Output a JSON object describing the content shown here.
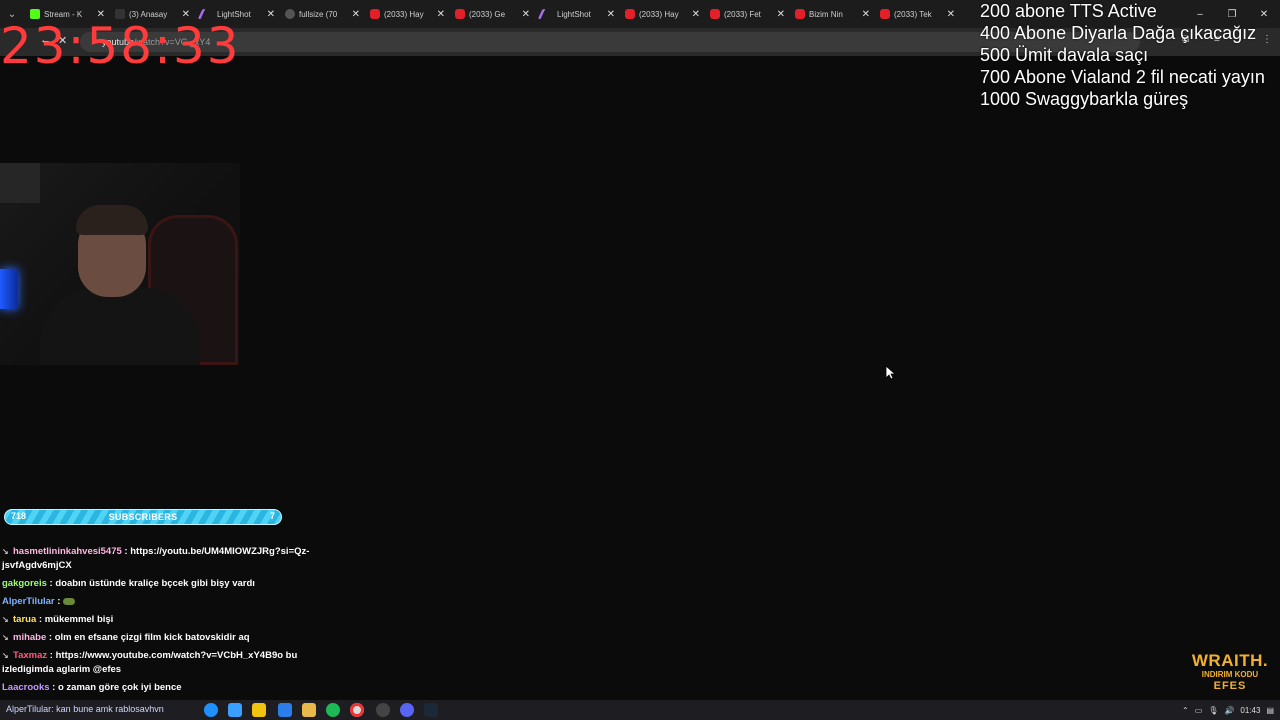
{
  "browser": {
    "tabs": [
      {
        "title": "Stream - K",
        "icon": "kick-icon"
      },
      {
        "title": "(3) Anasay",
        "icon": "x-icon"
      },
      {
        "title": "LightShot",
        "icon": "lightshot-icon"
      },
      {
        "title": "fullsize (70",
        "icon": "globe-icon"
      },
      {
        "title": "(2033) Hay",
        "icon": "youtube-icon"
      },
      {
        "title": "(2033) Ge",
        "icon": "youtube-icon"
      },
      {
        "title": "LightShot",
        "icon": "lightshot-icon"
      },
      {
        "title": "(2033) Hay",
        "icon": "youtube-icon"
      },
      {
        "title": "(2033) Fet",
        "icon": "youtube-icon"
      },
      {
        "title": "Bizim Nin",
        "icon": "youtube-icon"
      },
      {
        "title": "(2033) Tek",
        "icon": "youtube-icon"
      }
    ],
    "url_host": "youtube",
    "url_rest": "/watch?v=VC   _xY4"
  },
  "overlay": {
    "clock": "23:58:33",
    "goals": [
      "200 abone TTS Active",
      "400 Abone Diyarla Dağa çıkacağız",
      "500 Ümit davala saçı",
      "700 Abone Vialand 2 fil necati yayın",
      "1000 Swaggybarkla güreş"
    ],
    "subscribers": {
      "label": "SUBSCRIBERS",
      "current": "718",
      "right": "7"
    },
    "sponsor": {
      "brand": "WRAITH.",
      "code_label": "INDIRIM KODU",
      "code": "EFES"
    }
  },
  "chat": [
    {
      "user": "hasmetlininkahvesi5475",
      "color": "pink",
      "text": "https://youtu.be/UM4MIOWZJRg?si=Qz-jsvfAgdv6mjCX",
      "badge": true
    },
    {
      "user": "gakgoreis",
      "color": "green",
      "text": "doabın üstünde kraliçe bçcek gibi bişy vardı",
      "badge": false
    },
    {
      "user": "AlperTilular",
      "color": "blue",
      "text": "",
      "badge": false,
      "emote": true
    },
    {
      "user": "tarua",
      "color": "yellow",
      "text": "mükemmel bişi",
      "badge": true
    },
    {
      "user": "mihabe",
      "color": "pink",
      "text": "olm en efsane çizgi film kick batovskidir aq",
      "badge": true
    },
    {
      "user": "Taxmaz",
      "color": "red",
      "text": "https://www.youtube.com/watch?v=VCbH_xY4B9o bu izledigimda aglarim @efes",
      "badge": true
    },
    {
      "user": "Laacrooks",
      "color": "purple",
      "text": "o zaman göre çok iyi bence",
      "badge": false
    }
  ],
  "taskbar": {
    "search_text": "AlperTilular: kan bune amk rablosavhvn",
    "time": "01:43"
  }
}
